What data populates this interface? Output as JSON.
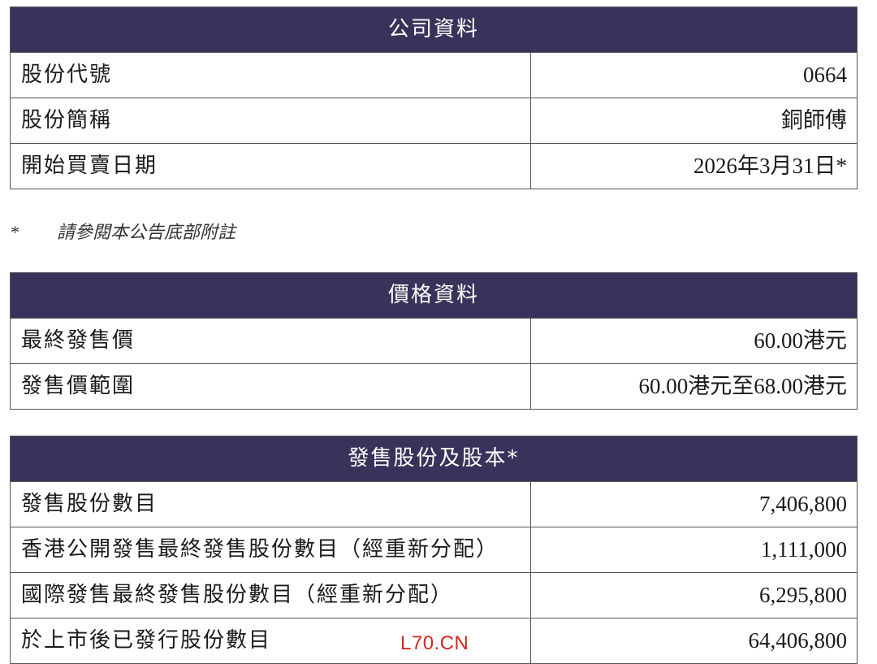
{
  "company": {
    "header": "公司資料",
    "rows": [
      {
        "label": "股份代號",
        "value": "0664"
      },
      {
        "label": "股份簡稱",
        "value": "銅師傅"
      },
      {
        "label": "開始買賣日期",
        "value": "2026年3月31日*"
      }
    ]
  },
  "footnote": {
    "marker": "*",
    "text": "請參閱本公告底部附註"
  },
  "price": {
    "header": "價格資料",
    "rows": [
      {
        "label": "最終發售價",
        "value": "60.00港元"
      },
      {
        "label": "發售價範圍",
        "value": "60.00港元至68.00港元"
      }
    ]
  },
  "shares": {
    "header": "發售股份及股本*",
    "rows": [
      {
        "label": "發售股份數目",
        "value": "7,406,800"
      },
      {
        "label": "香港公開發售最終發售股份數目（經重新分配）",
        "value": "1,111,000"
      },
      {
        "label": "國際發售最終發售股份數目（經重新分配）",
        "value": "6,295,800"
      },
      {
        "label": "於上市後已發行股份數目",
        "value": "64,406,800"
      }
    ]
  },
  "watermark": "L70.CN"
}
